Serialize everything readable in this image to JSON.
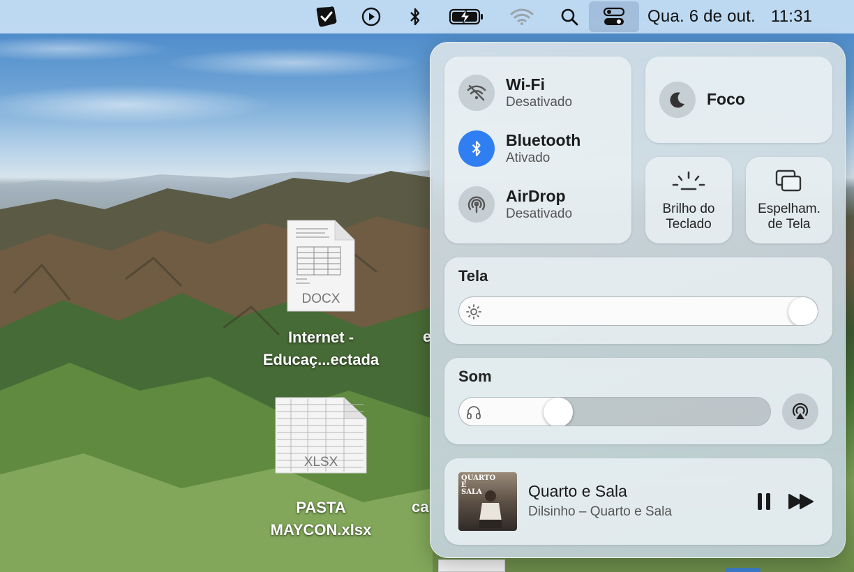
{
  "menubar": {
    "date": "Qua. 6 de out.",
    "time": "11:31",
    "icons": [
      "checklist-app-icon",
      "play-circle-icon",
      "bluetooth-icon",
      "battery-charging-icon",
      "wifi-off-icon",
      "search-icon",
      "control-center-icon"
    ]
  },
  "desktop": {
    "files": [
      {
        "badge": "DOCX",
        "name_line1": "Internet -",
        "name_line2": "Educaç...ectada"
      },
      {
        "badge": "XLSX",
        "name_line1": "PASTA",
        "name_line2": "MAYCON.xlsx"
      }
    ],
    "partial_labels": [
      "e",
      "ca"
    ]
  },
  "control_center": {
    "connectivity": [
      {
        "title": "Wi-Fi",
        "status": "Desativado",
        "icon": "wifi-off-icon",
        "active": false
      },
      {
        "title": "Bluetooth",
        "status": "Ativado",
        "icon": "bluetooth-icon",
        "active": true
      },
      {
        "title": "AirDrop",
        "status": "Desativado",
        "icon": "airdrop-icon",
        "active": false
      }
    ],
    "focus": {
      "label": "Foco",
      "icon": "moon-icon"
    },
    "keyboard_brightness": {
      "line1": "Brilho do",
      "line2": "Teclado",
      "icon": "keyboard-brightness-icon"
    },
    "screen_mirroring": {
      "line1": "Espelham.",
      "line2": "de Tela",
      "icon": "screen-mirroring-icon"
    },
    "display": {
      "title": "Tela",
      "level": 1.0,
      "icon": "sun-icon"
    },
    "sound": {
      "title": "Som",
      "level": 0.3,
      "icon": "headphones-icon",
      "airplay_icon": "airplay-audio-icon"
    },
    "now_playing": {
      "track": "Quarto e Sala",
      "subtitle": "Dilsinho – Quarto e Sala",
      "album_art_text": "QUARTO E SALA",
      "controls": [
        "pause-icon",
        "forward-icon"
      ]
    }
  },
  "colors": {
    "accent": "#2f7ff2",
    "menubar": "#c8dff4"
  }
}
